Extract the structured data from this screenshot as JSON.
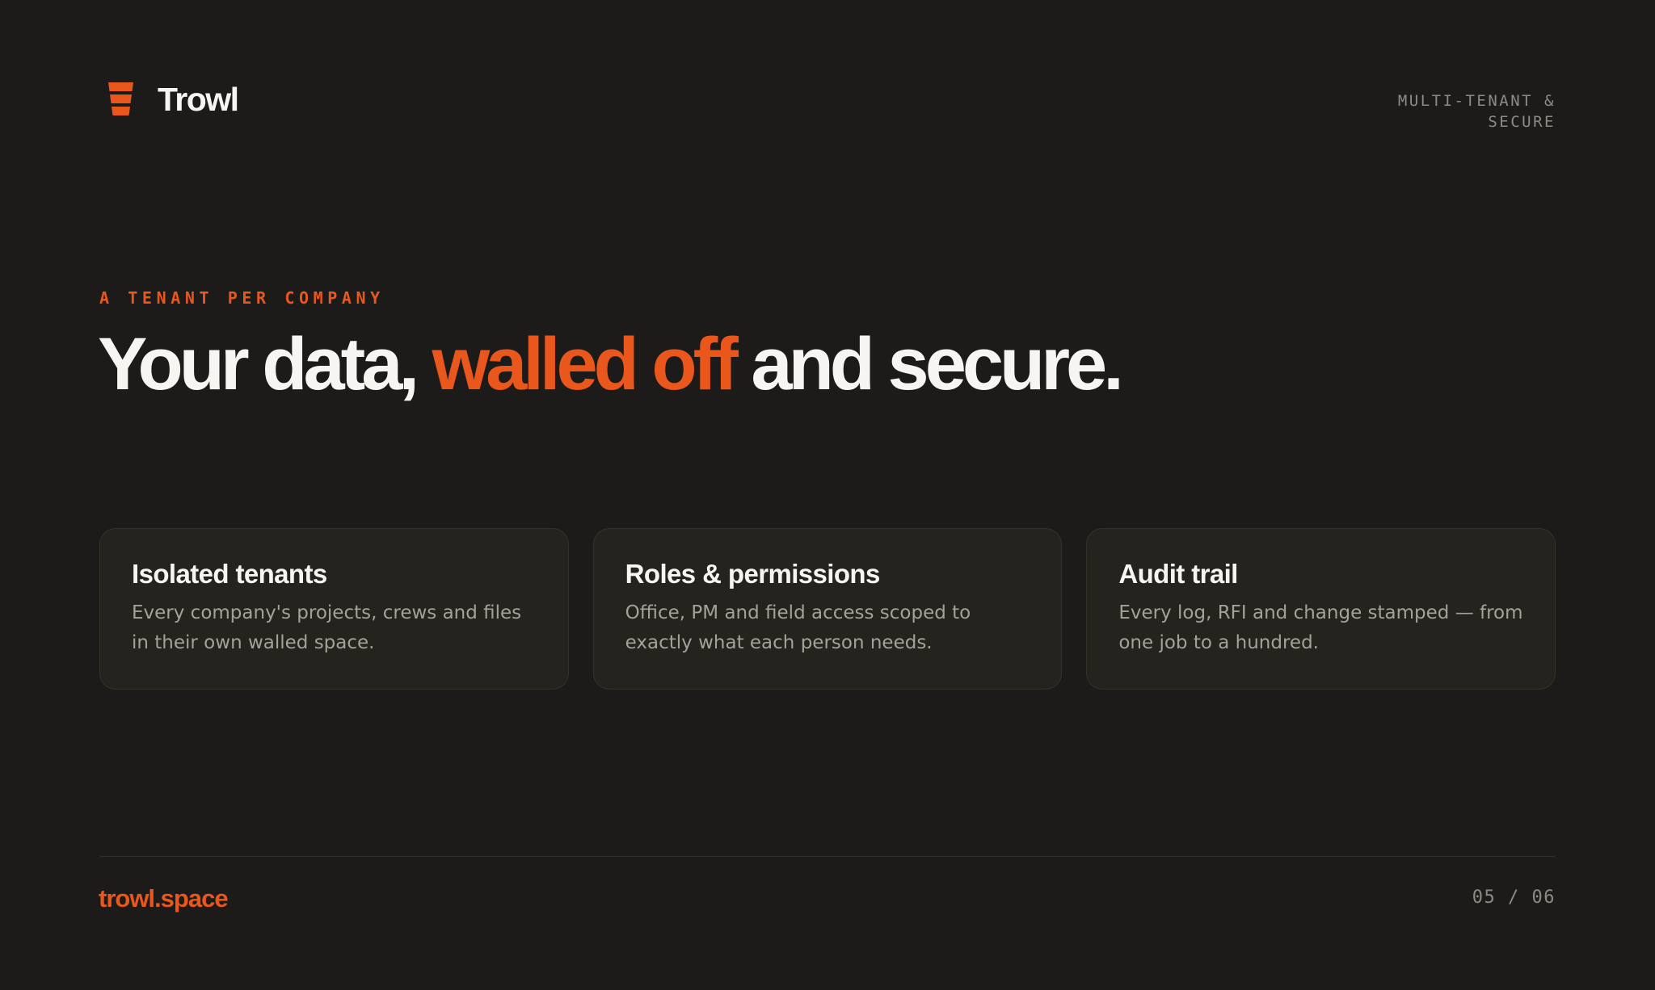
{
  "header": {
    "brand_name": "Trowl",
    "logo_icon": "trowel-stack-icon",
    "tag_line1": "MULTI-TENANT &",
    "tag_line2": "SECURE"
  },
  "hero": {
    "eyebrow": "A TENANT PER COMPANY",
    "headline_part1": "Your data, ",
    "headline_accent": "walled off",
    "headline_part2": " and secure."
  },
  "features": [
    {
      "title": "Isolated tenants",
      "body": "Every company's projects, crews and files in their own walled space."
    },
    {
      "title": "Roles & permissions",
      "body": "Office, PM and field access scoped to exactly what each person needs."
    },
    {
      "title": "Audit trail",
      "body": "Every log, RFI and change stamped — from one job to a hundred."
    }
  ],
  "footer": {
    "url": "trowl.space",
    "page_indicator": "05 / 06"
  },
  "colors": {
    "background": "#1c1b19",
    "accent": "#e9571d",
    "card_background": "#25231e",
    "text_primary": "#f7f5f1",
    "text_muted": "#a5a19a"
  }
}
